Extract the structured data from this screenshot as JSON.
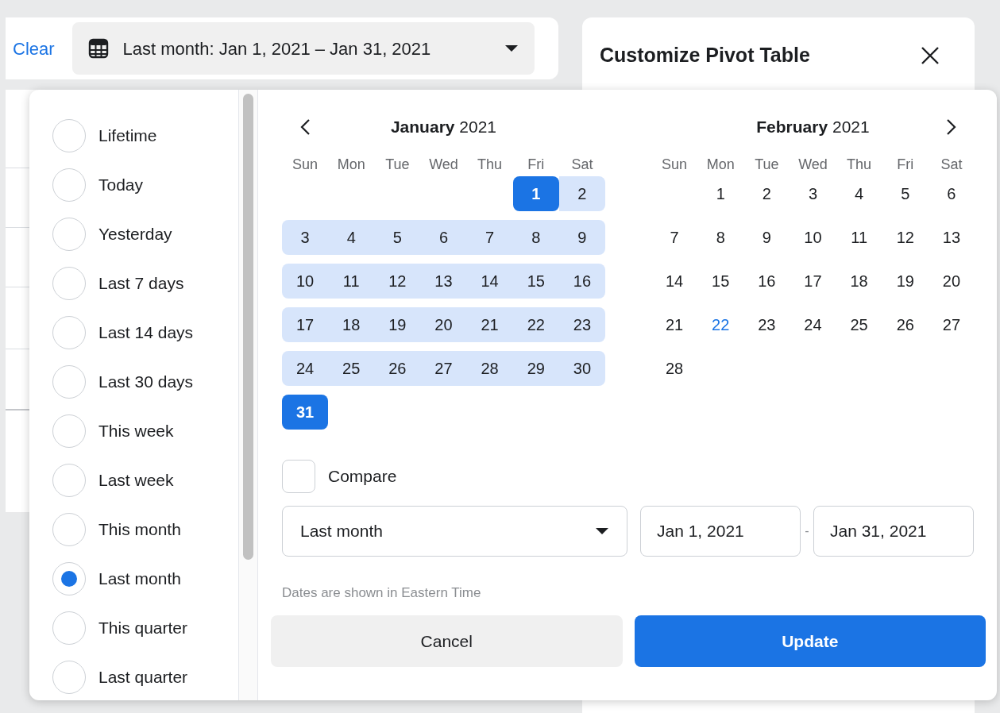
{
  "toolbar": {
    "clear_link": "Clear",
    "date_button": "Last month: Jan 1, 2021 – Jan 31, 2021"
  },
  "side_panel": {
    "title": "Customize Pivot Table"
  },
  "presets": [
    {
      "label": "Lifetime",
      "selected": false
    },
    {
      "label": "Today",
      "selected": false
    },
    {
      "label": "Yesterday",
      "selected": false
    },
    {
      "label": "Last 7 days",
      "selected": false
    },
    {
      "label": "Last 14 days",
      "selected": false
    },
    {
      "label": "Last 30 days",
      "selected": false
    },
    {
      "label": "This week",
      "selected": false
    },
    {
      "label": "Last week",
      "selected": false
    },
    {
      "label": "This month",
      "selected": false
    },
    {
      "label": "Last month",
      "selected": true
    },
    {
      "label": "This quarter",
      "selected": false
    },
    {
      "label": "Last quarter",
      "selected": false
    }
  ],
  "calendar": {
    "months": [
      {
        "title": "**January** 2021",
        "kind": "prev",
        "weekdays": [
          "Sun",
          "Mon",
          "Tue",
          "Wed",
          "Thu",
          "Fri",
          "Sat"
        ],
        "weeks": [
          [
            {
              "kind": "blank"
            },
            {
              "kind": "blank"
            },
            {
              "kind": "blank"
            },
            {
              "kind": "blank"
            },
            {
              "kind": "blank"
            },
            {
              "label": "1",
              "kind": "start"
            },
            {
              "label": "2",
              "kind": "range"
            }
          ],
          [
            {
              "label": "3",
              "kind": "range"
            },
            {
              "label": "4",
              "kind": "range"
            },
            {
              "label": "5",
              "kind": "range"
            },
            {
              "label": "6",
              "kind": "range"
            },
            {
              "label": "7",
              "kind": "range"
            },
            {
              "label": "8",
              "kind": "range"
            },
            {
              "label": "9",
              "kind": "range"
            }
          ],
          [
            {
              "label": "10",
              "kind": "range"
            },
            {
              "label": "11",
              "kind": "range"
            },
            {
              "label": "12",
              "kind": "range"
            },
            {
              "label": "13",
              "kind": "range"
            },
            {
              "label": "14",
              "kind": "range"
            },
            {
              "label": "15",
              "kind": "range"
            },
            {
              "label": "16",
              "kind": "range"
            }
          ],
          [
            {
              "label": "17",
              "kind": "range"
            },
            {
              "label": "18",
              "kind": "range"
            },
            {
              "label": "19",
              "kind": "range"
            },
            {
              "label": "20",
              "kind": "range"
            },
            {
              "label": "21",
              "kind": "range"
            },
            {
              "label": "22",
              "kind": "range"
            },
            {
              "label": "23",
              "kind": "range"
            }
          ],
          [
            {
              "label": "24",
              "kind": "range"
            },
            {
              "label": "25",
              "kind": "range"
            },
            {
              "label": "26",
              "kind": "range"
            },
            {
              "label": "27",
              "kind": "range"
            },
            {
              "label": "28",
              "kind": "range"
            },
            {
              "label": "29",
              "kind": "range"
            },
            {
              "label": "30",
              "kind": "range"
            }
          ],
          [
            {
              "label": "31",
              "kind": "end"
            }
          ]
        ]
      },
      {
        "title": "**February** 2021",
        "kind": "next",
        "weekdays": [
          "Sun",
          "Mon",
          "Tue",
          "Wed",
          "Thu",
          "Fri",
          "Sat"
        ],
        "weeks": [
          [
            {
              "kind": "blank"
            },
            {
              "label": "1",
              "kind": "plain"
            },
            {
              "label": "2",
              "kind": "plain"
            },
            {
              "label": "3",
              "kind": "plain"
            },
            {
              "label": "4",
              "kind": "plain"
            },
            {
              "label": "5",
              "kind": "plain"
            },
            {
              "label": "6",
              "kind": "plain"
            }
          ],
          [
            {
              "label": "7",
              "kind": "plain"
            },
            {
              "label": "8",
              "kind": "plain"
            },
            {
              "label": "9",
              "kind": "plain"
            },
            {
              "label": "10",
              "kind": "plain"
            },
            {
              "label": "11",
              "kind": "plain"
            },
            {
              "label": "12",
              "kind": "plain"
            },
            {
              "label": "13",
              "kind": "plain"
            }
          ],
          [
            {
              "label": "14",
              "kind": "plain"
            },
            {
              "label": "15",
              "kind": "plain"
            },
            {
              "label": "16",
              "kind": "plain"
            },
            {
              "label": "17",
              "kind": "plain"
            },
            {
              "label": "18",
              "kind": "plain"
            },
            {
              "label": "19",
              "kind": "plain"
            },
            {
              "label": "20",
              "kind": "plain"
            }
          ],
          [
            {
              "label": "21",
              "kind": "plain"
            },
            {
              "label": "22",
              "kind": "today"
            },
            {
              "label": "23",
              "kind": "plain"
            },
            {
              "label": "24",
              "kind": "plain"
            },
            {
              "label": "25",
              "kind": "plain"
            },
            {
              "label": "26",
              "kind": "plain"
            },
            {
              "label": "27",
              "kind": "plain"
            }
          ],
          [
            {
              "label": "28",
              "kind": "plain"
            }
          ]
        ]
      }
    ]
  },
  "compare": {
    "label": "Compare",
    "checked": false
  },
  "range_select": {
    "value": "Last month"
  },
  "start_date": "Jan 1, 2021",
  "separator": "-",
  "end_date": "Jan 31, 2021",
  "timezone_note": "Dates are shown in Eastern Time",
  "buttons": [
    {
      "label": "Cancel",
      "kind": "secondary"
    },
    {
      "label": "Update",
      "kind": "primary"
    }
  ]
}
